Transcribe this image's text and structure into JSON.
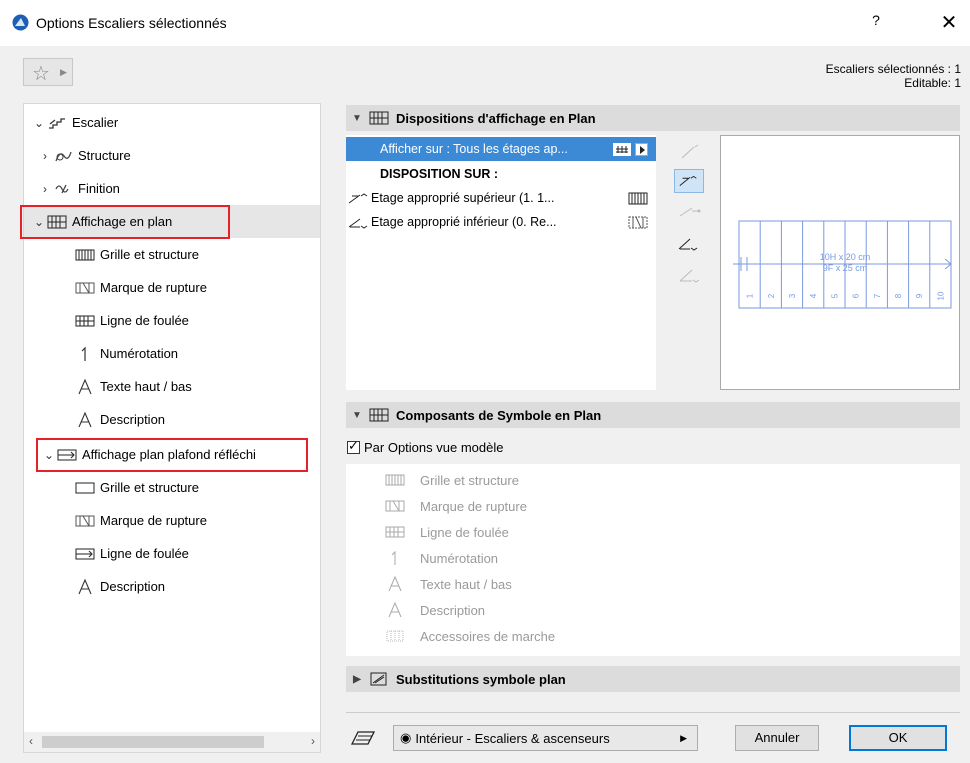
{
  "window": {
    "title": "Options Escaliers sélectionnés",
    "help": "?",
    "close": "✕"
  },
  "header": {
    "selected_count": "Escaliers sélectionnés : 1",
    "editable": "Editable: 1"
  },
  "tree": {
    "root": "Escalier",
    "items": [
      {
        "label": "Structure"
      },
      {
        "label": "Finition"
      },
      {
        "label": "Affichage en plan"
      },
      {
        "label": "Grille et structure"
      },
      {
        "label": "Marque de rupture"
      },
      {
        "label": "Ligne de foulée"
      },
      {
        "label": "Numérotation"
      },
      {
        "label": "Texte haut / bas"
      },
      {
        "label": "Description"
      },
      {
        "label": "Affichage plan plafond réfléchi"
      },
      {
        "label": "Grille et structure"
      },
      {
        "label": "Marque de rupture"
      },
      {
        "label": "Ligne de foulée"
      },
      {
        "label": "Description"
      }
    ]
  },
  "display_section": {
    "title": "Dispositions d'affichage en Plan",
    "show_on": "Afficher sur : Tous les étages ap...",
    "disposition_header": "DISPOSITION SUR :",
    "rows": [
      "Etage approprié supérieur (1. 1...",
      "Etage approprié inférieur (0. Re..."
    ],
    "preview": {
      "dim1": "10H x 20 cm",
      "dim2": "9F x 25 cm",
      "numbers": [
        "1",
        "2",
        "3",
        "4",
        "5",
        "6",
        "7",
        "8",
        "9",
        "10"
      ]
    }
  },
  "symbol_section": {
    "title": "Composants de Symbole en Plan",
    "checkbox_label": "Par Options vue modèle",
    "items": [
      "Grille et structure",
      "Marque de rupture",
      "Ligne de foulée",
      "Numérotation",
      "Texte haut / bas",
      "Description",
      "Accessoires de marche"
    ]
  },
  "override_section": {
    "title": "Substitutions symbole plan"
  },
  "footer": {
    "view_option": "Intérieur - Escaliers & ascenseurs",
    "cancel": "Annuler",
    "ok": "OK"
  },
  "colors": {
    "selection_blue": "#3c8ad6",
    "highlight_red": "#e8202a",
    "preview_line": "#7a9ae0"
  }
}
